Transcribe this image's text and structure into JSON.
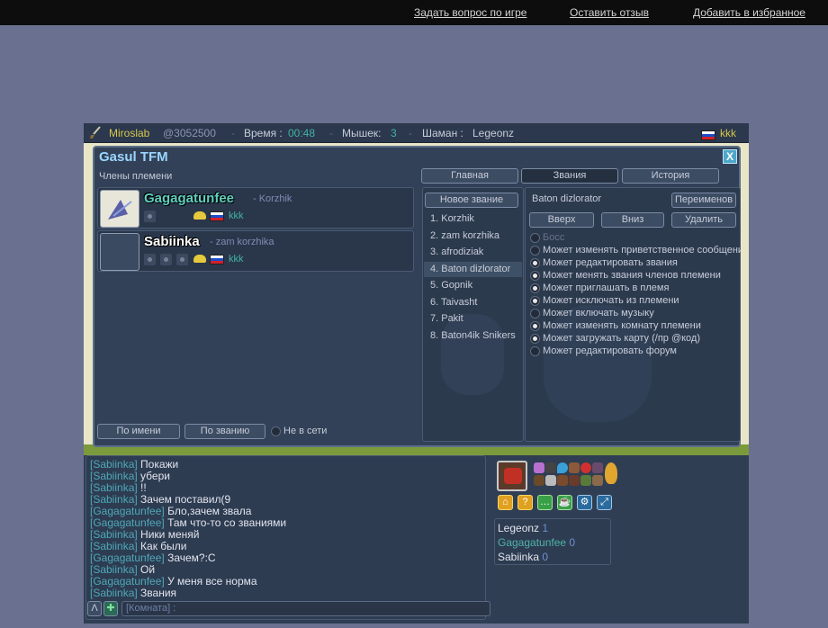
{
  "top_links": [
    "Задать вопрос по игре",
    "Оставить отзыв",
    "Добавить в избранное"
  ],
  "hud": {
    "player": "Miroslab",
    "player_id": "@3052500",
    "time_label": "Время :",
    "time_value": "00:48",
    "mice_label": "Мышек:",
    "mice_value": "3",
    "shaman_label": "Шаман :",
    "shaman_value": "Legeonz",
    "lang": "kkk"
  },
  "tribe": {
    "title": "Gasul TFM",
    "close": "X",
    "members_label": "Члены племени",
    "members": [
      {
        "name": "Gagagatunfee",
        "rank": "- Korzhik",
        "lang": "kkk"
      },
      {
        "name": "Sabiinka",
        "rank": "- zam korzhika",
        "lang": "kkk"
      }
    ],
    "sort_by_name": "По имени",
    "sort_by_rank": "По званию",
    "offline": "Не в сети",
    "tabs": [
      "Главная",
      "Звания",
      "История"
    ],
    "new_rank": "Новое звание",
    "selected_rank": "Baton dizlorator",
    "rename": "Переименов",
    "up": "Вверх",
    "down": "Вниз",
    "delete": "Удалить",
    "ranks": [
      "1. Korzhik",
      "2. zam korzhika",
      "3. afrodiziak",
      "4. Baton dizlorator",
      "5. Gopnik",
      "6. Taivasht",
      "7. Pakit",
      "8. Baton4ik Snikers"
    ],
    "permissions": [
      {
        "label": "Босс",
        "on": false,
        "disabled": true
      },
      {
        "label": "Может изменять приветственное сообщение",
        "on": false
      },
      {
        "label": "Может редактировать звания",
        "on": true
      },
      {
        "label": "Может менять звания членов племени",
        "on": true
      },
      {
        "label": "Может приглашать в племя",
        "on": true
      },
      {
        "label": "Может исключать из племени",
        "on": true
      },
      {
        "label": "Может включать музыку",
        "on": false
      },
      {
        "label": "Может изменять комнату племени",
        "on": true
      },
      {
        "label": "Может загружать карту (/пр @код)",
        "on": true
      },
      {
        "label": "Может редактировать форум",
        "on": false
      }
    ]
  },
  "chat": {
    "lines": [
      {
        "who": "[Sabiinka]",
        "msg": "Покажи"
      },
      {
        "who": "[Sabiinka]",
        "msg": "убери"
      },
      {
        "who": "[Sabiinka]",
        "msg": "!!"
      },
      {
        "who": "[Sabiinka]",
        "msg": "Зачем поставил(9"
      },
      {
        "who": "[Gagagatunfee]",
        "msg": "Бло,зачем звала"
      },
      {
        "who": "[Gagagatunfee]",
        "msg": "Там что-то со званиями"
      },
      {
        "who": "[Sabiinka]",
        "msg": "Ники меняй"
      },
      {
        "who": "[Sabiinka]",
        "msg": "Как были"
      },
      {
        "who": "[Gagagatunfee]",
        "msg": "Зачем?:С"
      },
      {
        "who": "[Sabiinka]",
        "msg": "Ой"
      },
      {
        "who": "[Gagagatunfee]",
        "msg": "У меня все норма"
      },
      {
        "who": "[Sabiinka]",
        "msg": "Звания"
      }
    ],
    "input_placeholder": "[Комната] :",
    "btn_a": "Λ",
    "btn_plus": "✚"
  },
  "players": [
    {
      "name": "Legeonz",
      "score": "1"
    },
    {
      "name": "Gagagatunfee",
      "score": "0"
    },
    {
      "name": "Sabiinka",
      "score": "0"
    }
  ]
}
